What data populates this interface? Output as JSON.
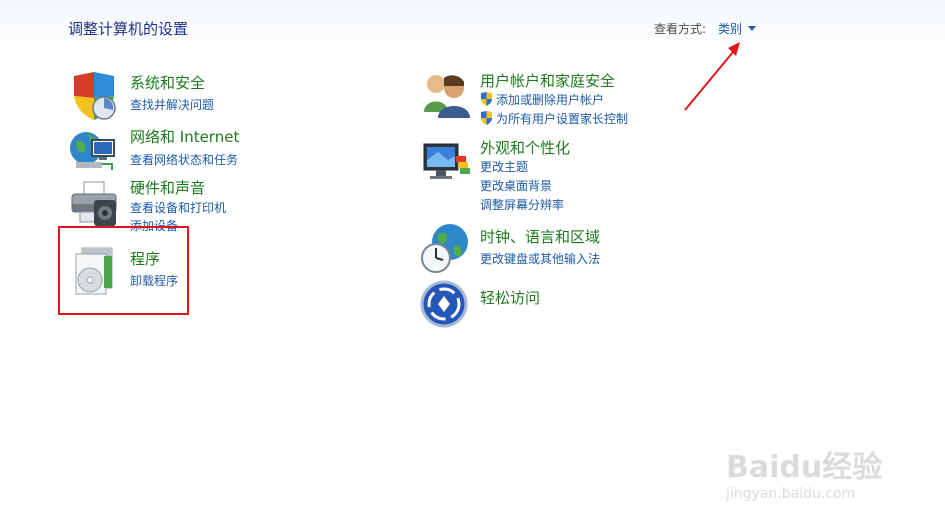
{
  "header": {
    "title": "调整计算机的设置",
    "view_by_label": "查看方式:",
    "view_by_value": "类别"
  },
  "left_column": [
    {
      "title": "系统和安全",
      "icon": "shield-system-icon",
      "links": [
        "查找并解决问题"
      ]
    },
    {
      "title": "网络和 Internet",
      "icon": "network-globe-icon",
      "links": [
        "查看网络状态和任务"
      ]
    },
    {
      "title": "硬件和声音",
      "icon": "printer-hardware-icon",
      "links": [
        "查看设备和打印机",
        "添加设备"
      ]
    },
    {
      "title": "程序",
      "icon": "programs-disc-icon",
      "links": [
        "卸载程序"
      ]
    }
  ],
  "right_column": [
    {
      "title": "用户帐户和家庭安全",
      "icon": "users-icon",
      "links": [
        "添加或删除用户帐户",
        "为所有用户设置家长控制"
      ]
    },
    {
      "title": "外观和个性化",
      "icon": "appearance-monitor-icon",
      "links": [
        "更改主题",
        "更改桌面背景",
        "调整屏幕分辨率"
      ]
    },
    {
      "title": "时钟、语言和区域",
      "icon": "clock-globe-icon",
      "links": [
        "更改键盘或其他输入法"
      ]
    },
    {
      "title": "轻松访问",
      "icon": "ease-of-access-icon",
      "links": []
    }
  ],
  "watermark": {
    "brand": "Baidu经验",
    "url": "jingyan.baidu.com"
  },
  "colors": {
    "title_green": "#1e7a1e",
    "link_blue": "#1e5aa8",
    "highlight_red": "#e0161c"
  }
}
